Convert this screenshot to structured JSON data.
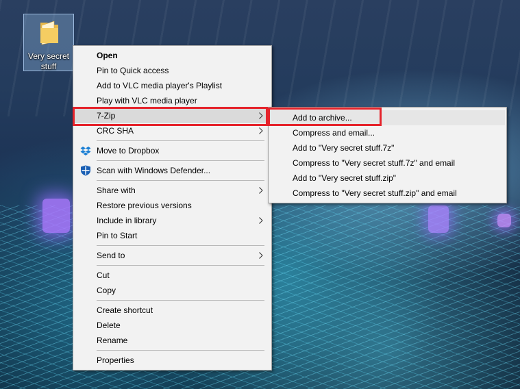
{
  "desktop": {
    "icon_label": "Very secret stuff"
  },
  "context_menu": {
    "items": [
      {
        "label": "Open"
      },
      {
        "label": "Pin to Quick access"
      },
      {
        "label": "Add to VLC media player's Playlist"
      },
      {
        "label": "Play with VLC media player"
      },
      {
        "label": "7-Zip"
      },
      {
        "label": "CRC SHA"
      },
      {
        "label": "Move to Dropbox"
      },
      {
        "label": "Scan with Windows Defender..."
      },
      {
        "label": "Share with"
      },
      {
        "label": "Restore previous versions"
      },
      {
        "label": "Include in library"
      },
      {
        "label": "Pin to Start"
      },
      {
        "label": "Send to"
      },
      {
        "label": "Cut"
      },
      {
        "label": "Copy"
      },
      {
        "label": "Create shortcut"
      },
      {
        "label": "Delete"
      },
      {
        "label": "Rename"
      },
      {
        "label": "Properties"
      }
    ]
  },
  "submenu_7zip": {
    "items": [
      {
        "label": "Add to archive..."
      },
      {
        "label": "Compress and email..."
      },
      {
        "label": "Add to \"Very secret stuff.7z\""
      },
      {
        "label": "Compress to \"Very secret stuff.7z\" and email"
      },
      {
        "label": "Add to \"Very secret stuff.zip\""
      },
      {
        "label": "Compress to \"Very secret stuff.zip\" and email"
      }
    ]
  },
  "icons": {
    "desktop": "folder-icon",
    "dropbox": "dropbox-icon",
    "defender": "windows-defender-shield-icon",
    "submenu_arrow": "chevron-right-icon"
  },
  "colors": {
    "highlight_box": "#e5232b",
    "menu_bg": "#f2f2f2",
    "menu_hover": "#dadada"
  }
}
